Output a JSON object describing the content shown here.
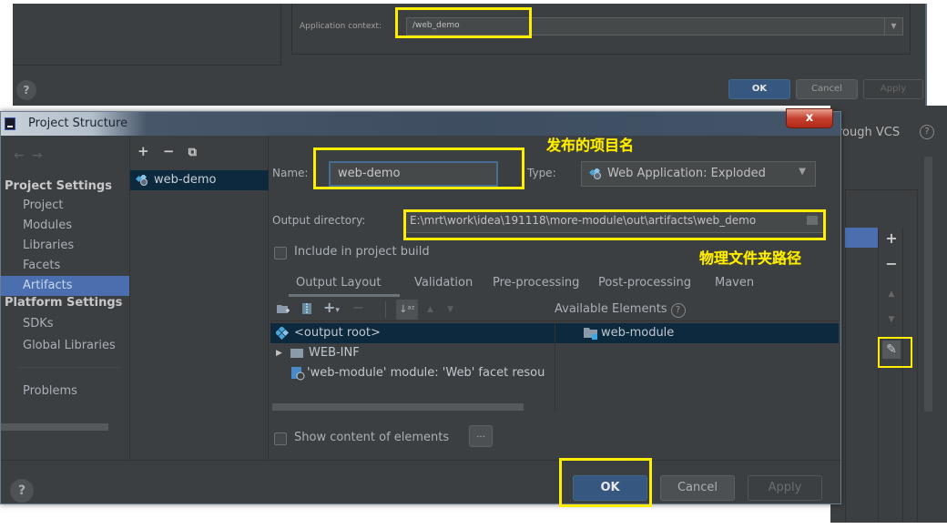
{
  "background_dialog": {
    "app_context_label": "Application context:",
    "app_context_value": "/web_demo",
    "help_glyph": "?",
    "buttons": {
      "ok": "OK",
      "cancel": "Cancel",
      "apply": "Apply"
    }
  },
  "right_panel": {
    "vcs_text": "rough VCS",
    "help_glyph": "?",
    "tools": {
      "add": "+",
      "remove": "−",
      "up": "▲",
      "down": "▼",
      "edit": "✎"
    }
  },
  "dialog": {
    "title": "Project Structure",
    "close_glyph": "x",
    "nav": {
      "back": "←",
      "forward": "→"
    },
    "sidebar": {
      "project_settings": "Project Settings",
      "project_items": [
        "Project",
        "Modules",
        "Libraries",
        "Facets",
        "Artifacts"
      ],
      "active_item": "Artifacts",
      "platform_settings": "Platform Settings",
      "platform_items": [
        "SDKs",
        "Global Libraries"
      ],
      "problems": "Problems"
    },
    "artifacts": {
      "toolbar": {
        "add": "+",
        "remove": "−",
        "copy": "⧉"
      },
      "items": [
        "web-demo"
      ]
    },
    "form": {
      "name_label": "Name:",
      "name_value": "web-demo",
      "type_label": "Type:",
      "type_value": "Web Application: Exploded",
      "output_dir_label": "Output directory:",
      "output_dir_value": "E:\\mrt\\work\\idea\\191118\\more-module\\out\\artifacts\\web_demo",
      "include_build_label": "Include in project build",
      "include_build_checked": false,
      "tabs": [
        "Output Layout",
        "Validation",
        "Pre-processing",
        "Post-processing",
        "Maven"
      ],
      "active_tab": "Output Layout",
      "available_elements_label": "Available Elements",
      "layout_tree": [
        {
          "label": "<output root>",
          "selected": true
        },
        {
          "label": "WEB-INF",
          "expandable": true
        },
        {
          "label": "'web-module' module: 'Web' facet resou"
        }
      ],
      "available_tree": [
        {
          "label": "web-module",
          "selected": true
        }
      ],
      "show_content_label": "Show content of elements",
      "show_content_checked": false,
      "dots_label": "..."
    },
    "footer": {
      "help_glyph": "?",
      "ok": "OK",
      "cancel": "Cancel",
      "apply": "Apply"
    }
  },
  "annotations": {
    "project_name": "发布的项目名",
    "folder_path": "物理文件夹路径"
  },
  "colors": {
    "highlight": "#ffee00",
    "accent": "#4b6eaf",
    "primary_button": "#365880",
    "selection": "#0d293e"
  }
}
